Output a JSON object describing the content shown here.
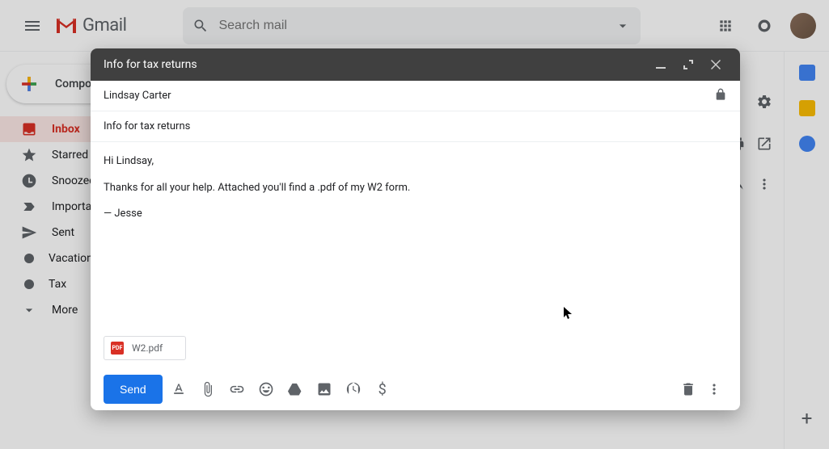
{
  "header": {
    "logo_text": "Gmail",
    "search_placeholder": "Search mail"
  },
  "sidebar": {
    "compose_label": "Compose",
    "items": [
      {
        "label": "Inbox"
      },
      {
        "label": "Starred"
      },
      {
        "label": "Snoozed"
      },
      {
        "label": "Important"
      },
      {
        "label": "Sent"
      },
      {
        "label": "Vacation"
      },
      {
        "label": "Tax"
      },
      {
        "label": "More"
      }
    ]
  },
  "compose": {
    "title": "Info for tax returns",
    "to": "Lindsay Carter",
    "subject": "Info for tax returns",
    "body_line1": "Hi Lindsay,",
    "body_line2": "Thanks for all your help. Attached you'll find a .pdf of my W2 form.",
    "body_signature": "— Jesse",
    "attachment_name": "W2.pdf",
    "send_label": "Send"
  }
}
